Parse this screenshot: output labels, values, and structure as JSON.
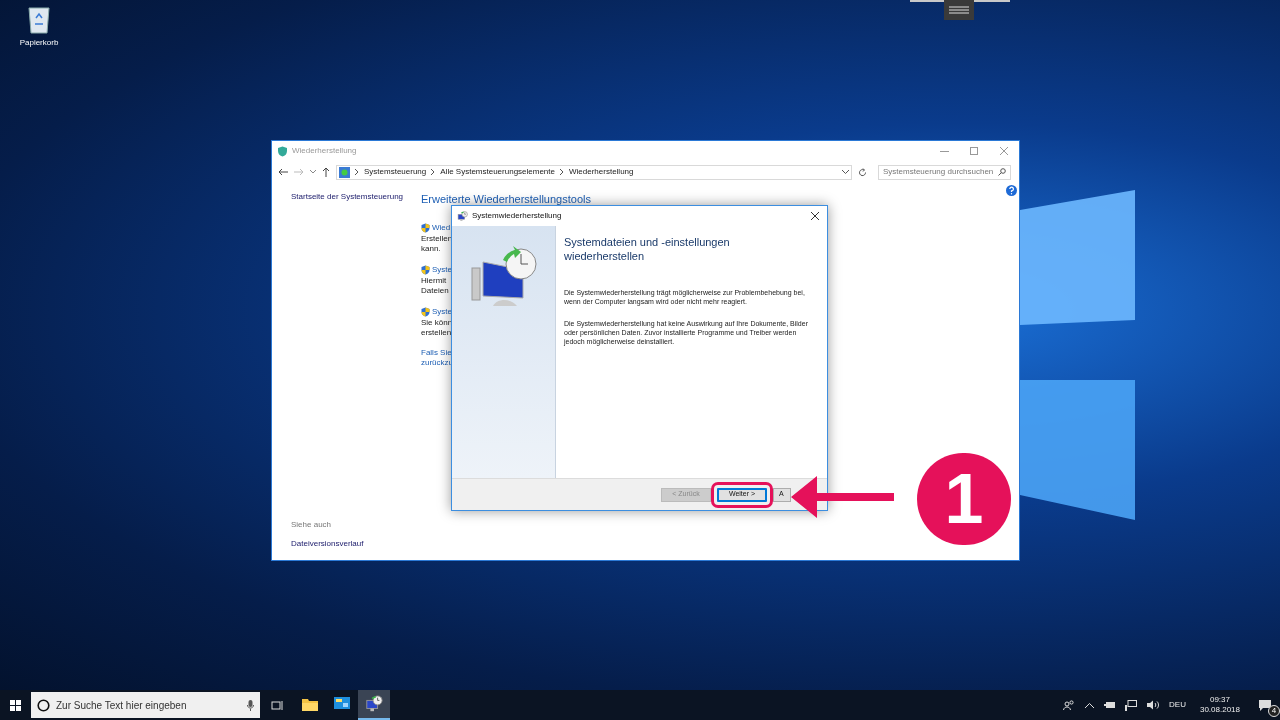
{
  "desktop": {
    "icons": [
      {
        "label": "Papierkorb"
      }
    ]
  },
  "window": {
    "title": "Wiederherstellung",
    "breadcrumbs": [
      "Systemsteuerung",
      "Alle Systemsteuerungselemente",
      "Wiederherstellung"
    ],
    "search": {
      "placeholder": "Systemsteuerung durchsuchen"
    },
    "sidebar": {
      "home": "Startseite der Systemsteuerung",
      "see_also": "Siehe auch",
      "links": [
        "Dateiversionsverlauf"
      ]
    },
    "heading": "Erweiterte Wiederherstellungstools",
    "tools": [
      {
        "title": "Wied",
        "lines": [
          "Erstellen",
          "kann."
        ]
      },
      {
        "title": "Syste",
        "lines": [
          "Hiermit",
          "Dateien"
        ]
      },
      {
        "title": "Syste",
        "lines": [
          "Sie könn",
          "erstellen"
        ]
      }
    ],
    "note": [
      "Falls Sie",
      "zurückzu"
    ]
  },
  "dialog": {
    "title": "Systemwiederherstellung",
    "heading": "Systemdateien und -einstellungen wiederherstellen",
    "paragraphs": [
      "Die Systemwiederherstellung trägt möglicherweise zur Problembehebung bei, wenn der Computer langsam wird oder nicht mehr reagiert.",
      "Die Systemwiederherstellung hat keine Auswirkung auf Ihre Dokumente, Bilder oder persönlichen Daten. Zuvor installierte Programme und Treiber werden jedoch möglicherweise deinstalliert."
    ],
    "buttons": [
      {
        "label": "< Zurück",
        "disabled": true,
        "default": false,
        "highlighted": false
      },
      {
        "label": "Weiter >",
        "disabled": false,
        "default": true,
        "highlighted": true
      },
      {
        "label": "A",
        "disabled": false,
        "default": false,
        "highlighted": false
      }
    ]
  },
  "annotation": {
    "number": "1"
  },
  "taskbar": {
    "search": {
      "placeholder": "Zur Suche Text hier eingeben"
    },
    "apps": [
      {
        "kind": "explorer",
        "active": false
      },
      {
        "kind": "control-panel",
        "active": false
      },
      {
        "kind": "restore",
        "active": true
      }
    ],
    "language": "DEU",
    "time": "09:37",
    "date": "30.08.2018",
    "notifications": "4"
  }
}
